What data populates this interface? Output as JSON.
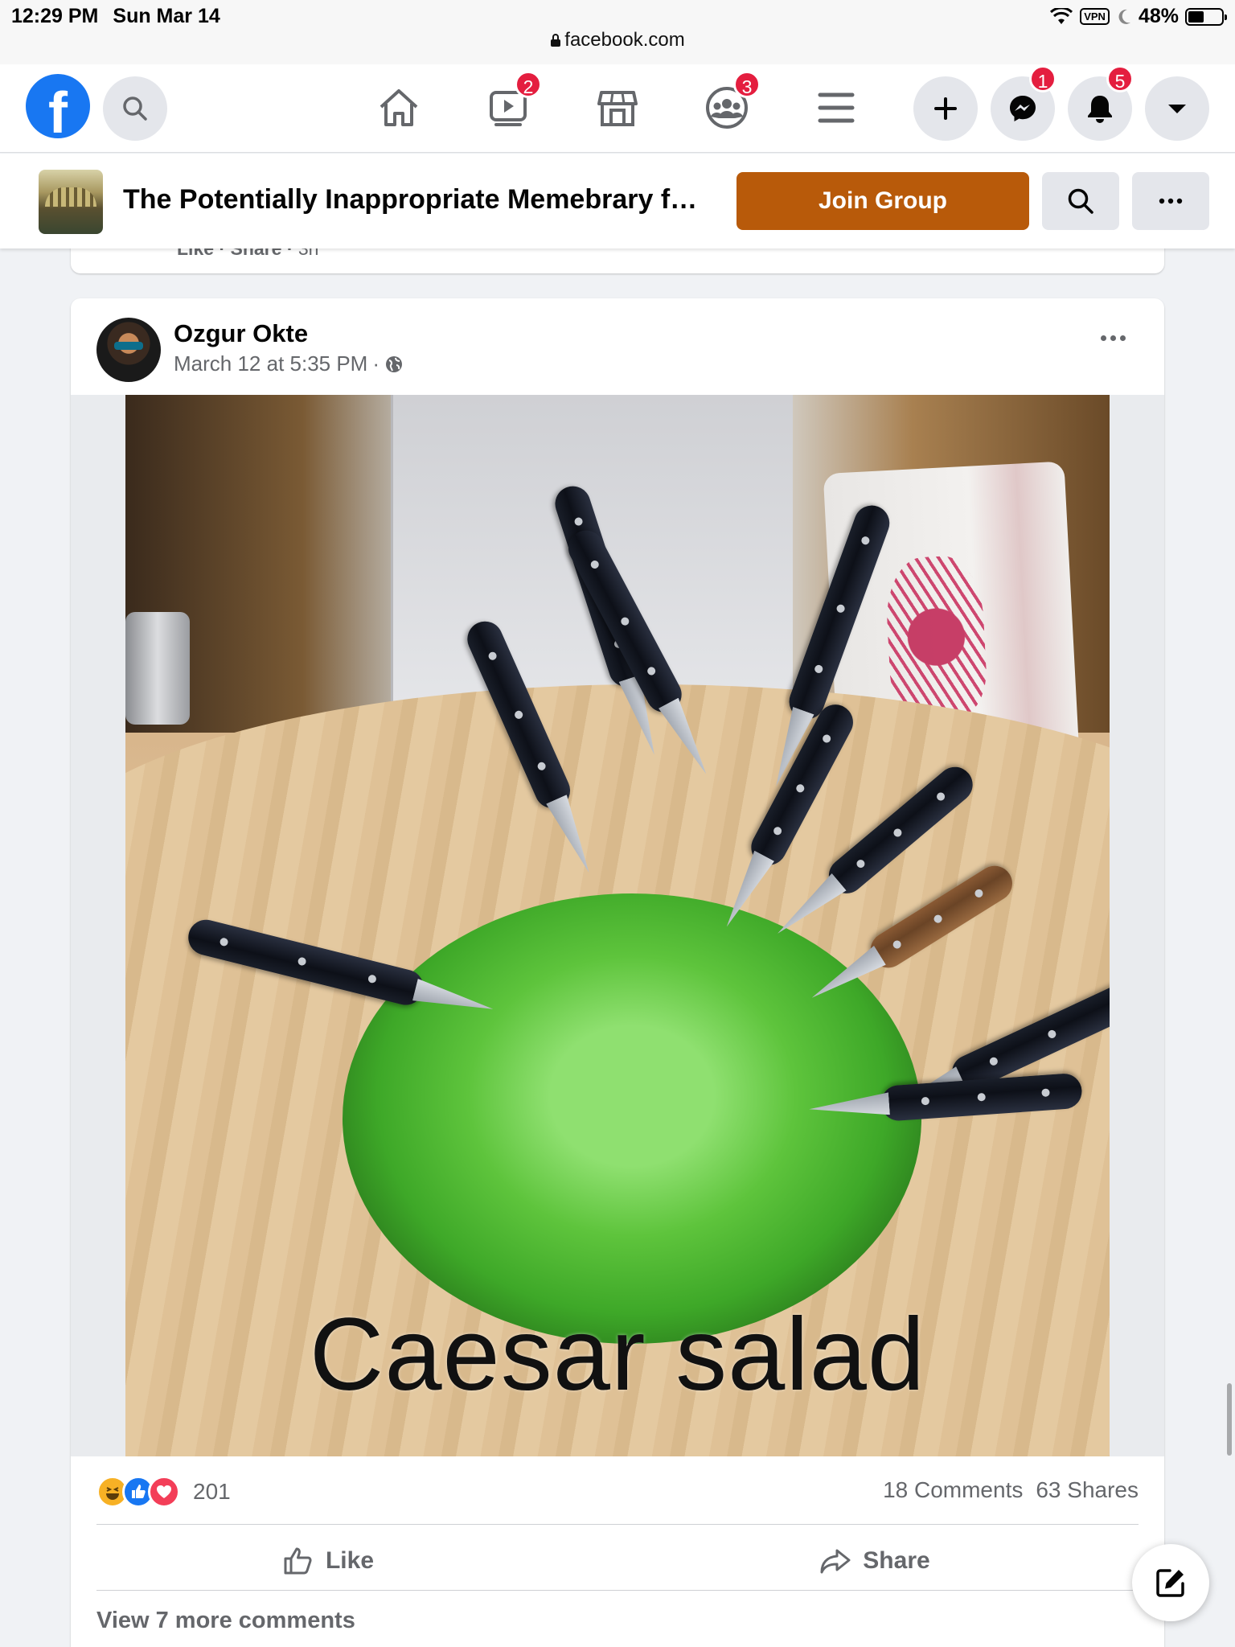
{
  "status_bar": {
    "time": "12:29 PM",
    "date": "Sun Mar 14",
    "vpn": "VPN",
    "battery": "48%",
    "battery_level": 0.48
  },
  "browser": {
    "url": "facebook.com"
  },
  "top_nav": {
    "logo": "f",
    "icons": [
      "search-icon",
      "home-icon",
      "watch-icon",
      "marketplace-icon",
      "groups-icon",
      "menu-icon",
      "create-icon",
      "messenger-icon",
      "notifications-icon",
      "account-dropdown-icon"
    ],
    "watch_badge": "2",
    "groups_badge": "3",
    "messenger_badge": "1",
    "notifications_badge": "5"
  },
  "group_bar": {
    "title": "The Potentially Inappropriate Memebrary for ...",
    "join_label": "Join Group"
  },
  "previous_post": {
    "like": "Like",
    "share": "Share",
    "time": "3h"
  },
  "post": {
    "author": "Ozgur Okte",
    "timestamp": "March 12 at 5:35 PM",
    "privacy_icon": "globe-icon",
    "image_caption": "Caesar salad",
    "reaction_count": "201",
    "reaction_icons": [
      "haha-icon",
      "like-icon",
      "love-icon"
    ],
    "comments": "18 Comments",
    "shares": "63 Shares",
    "like_label": "Like",
    "share_label": "Share",
    "view_more": "View 7 more comments"
  },
  "colors": {
    "facebook_blue": "#1877f2",
    "join_button": "#b85a0a",
    "badge_red": "#e41e3f"
  }
}
